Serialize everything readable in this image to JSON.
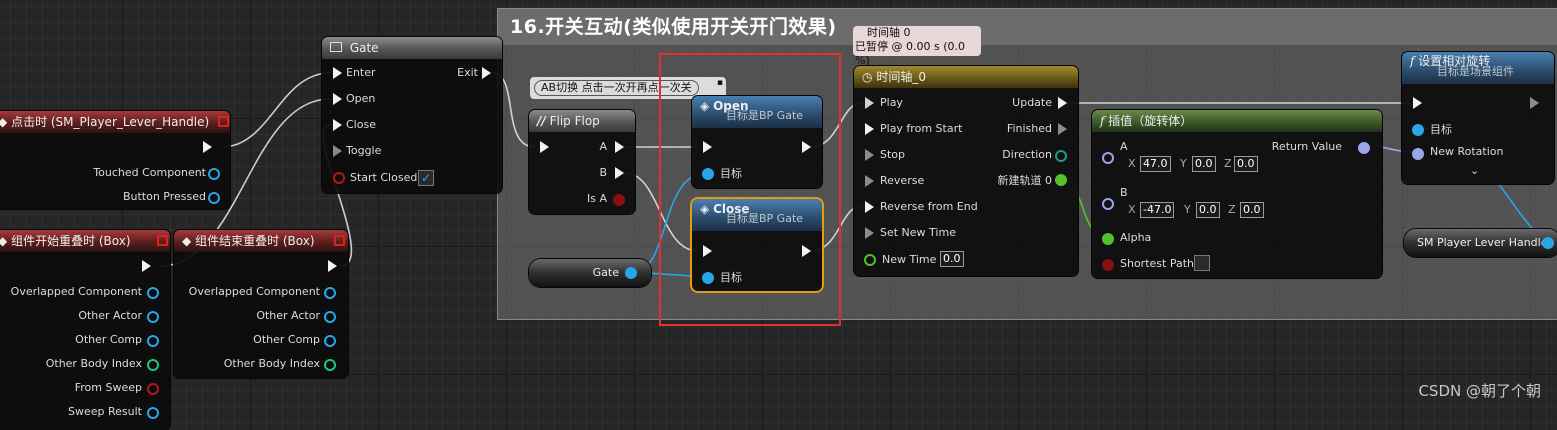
{
  "comment": {
    "title": "16.开关互动(类似使用开关开门效果)"
  },
  "timeline_status": {
    "line1": "时间轴 0",
    "line2": "已暂停 @ 0.00 s (0.0 %)"
  },
  "ab_tip": {
    "text": "AB切换 点击一次开再点一次关"
  },
  "watermark": "CSDN @朝了个朝",
  "nodes": {
    "click": {
      "title": "点击时 (SM_Player_Lever_Handle)",
      "pins": [
        "Touched Component",
        "Button Pressed"
      ]
    },
    "begin_overlap": {
      "title": "组件开始重叠时 (Box)",
      "pins": [
        "Overlapped Component",
        "Other Actor",
        "Other Comp",
        "Other Body Index",
        "From Sweep",
        "Sweep Result"
      ]
    },
    "end_overlap": {
      "title": "组件结束重叠时 (Box)",
      "pins": [
        "Overlapped Component",
        "Other Actor",
        "Other Comp",
        "Other Body Index"
      ]
    },
    "gate": {
      "title": "Gate",
      "inputs": [
        "Enter",
        "Open",
        "Close",
        "Toggle",
        "Start Closed"
      ],
      "output": "Exit",
      "start_closed": "✓"
    },
    "flipflop": {
      "title": "Flip Flop",
      "outputs": [
        "A",
        "B",
        "Is A"
      ]
    },
    "open": {
      "title": "Open",
      "subtitle": "目标是BP Gate",
      "target": "目标"
    },
    "close": {
      "title": "Close",
      "subtitle": "目标是BP Gate",
      "target": "目标"
    },
    "gate_var": {
      "label": "Gate"
    },
    "timeline": {
      "title": "时间轴_0",
      "inputs": [
        "Play",
        "Play from Start",
        "Stop",
        "Reverse",
        "Reverse from End",
        "Set New Time",
        "New Time"
      ],
      "outputs": [
        "Update",
        "Finished",
        "Direction",
        "新建轨道 0"
      ],
      "new_time": "0.0"
    },
    "lerp": {
      "title": "插值（旋转体）",
      "a_label": "A",
      "b_label": "B",
      "a": {
        "x": "47.0",
        "y": "0.0",
        "z": "0.0"
      },
      "b": {
        "x": "-47.0",
        "y": "0.0",
        "z": "0.0"
      },
      "alpha": "Alpha",
      "shortest": "Shortest Path",
      "ret": "Return Value",
      "xyz": [
        "X",
        "Y",
        "Z"
      ]
    },
    "setrot": {
      "title": "设置相对旋转",
      "subtitle": "目标是场景组件",
      "pins": [
        "目标",
        "New Rotation"
      ]
    },
    "handle_var": {
      "label": "SM Player Lever Handle"
    }
  }
}
